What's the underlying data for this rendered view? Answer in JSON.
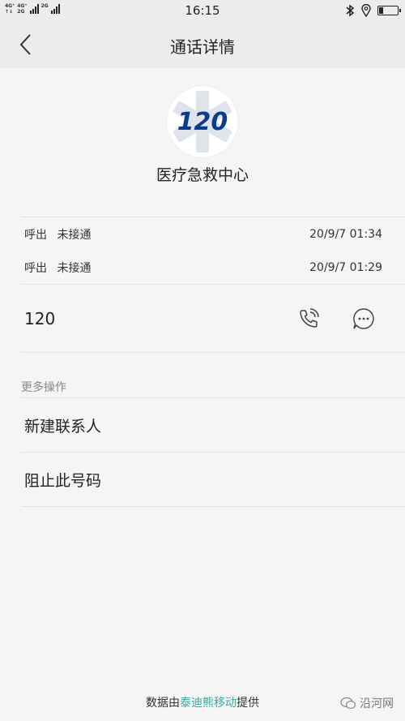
{
  "status_bar": {
    "network_1": "4G⁺",
    "network_1_sub": "↑↓",
    "network_2_top": "4G⁺",
    "network_2_bottom": "2G",
    "network_3": "2G",
    "time": "16:15",
    "icons": [
      "bluetooth-icon",
      "location-icon",
      "battery-icon"
    ],
    "battery_level": 0.25
  },
  "nav": {
    "title": "通话详情"
  },
  "contact": {
    "avatar_text": "120",
    "name": "医疗急救中心",
    "number": "120"
  },
  "calls": [
    {
      "type": "呼出",
      "status": "未接通",
      "time": "20/9/7 01:34"
    },
    {
      "type": "呼出",
      "status": "未接通",
      "time": "20/9/7 01:29"
    }
  ],
  "more_actions": {
    "label": "更多操作",
    "items": [
      "新建联系人",
      "阻止此号码"
    ]
  },
  "footer": {
    "prefix": "数据由",
    "link": "泰迪熊移动",
    "suffix": "提供",
    "watermark": "沿河网"
  },
  "colors": {
    "background": "#f5f5f5",
    "bar": "#ececec",
    "link": "#3aa89a",
    "avatar_blue": "#0a3c8c"
  }
}
